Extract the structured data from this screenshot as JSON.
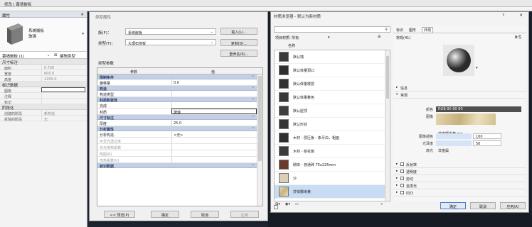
{
  "ribbon": {
    "context": "修改 | 幕墙嵌板"
  },
  "properties": {
    "header": "属性",
    "family": "系统嵌板",
    "type": "玻璃",
    "selector": "幕墙嵌板 (1)",
    "edit_type": "编辑类型",
    "categories": [
      {
        "name": "尺寸标注",
        "rows": [
          [
            "面积",
            "0.720"
          ],
          [
            "宽度",
            "600.0"
          ],
          [
            "高度",
            "1200.0"
          ]
        ]
      },
      {
        "name": "标识数据",
        "rows": [
          [
            "图像",
            ""
          ],
          [
            "注释",
            ""
          ],
          [
            "标记",
            ""
          ]
        ]
      },
      {
        "name": "阶段化",
        "rows": [
          [
            "创建的阶段",
            "新构造"
          ],
          [
            "拆除的阶段",
            "无"
          ]
        ]
      }
    ]
  },
  "type_props": {
    "title": "类型属性",
    "family_label": "族(F)：",
    "family_value": "系统嵌板",
    "type_label": "类型(T)：",
    "type_value": "大理石地板",
    "load_button": "载入(L)...",
    "duplicate_button": "复制(D)...",
    "rename_button": "重命名(R)...",
    "section_label": "类型参数",
    "col_param": "参数",
    "col_value": "值",
    "groups": [
      {
        "name": "限制条件",
        "rows": [
          {
            "k": "偏移量",
            "v": "0.0"
          }
        ]
      },
      {
        "name": "构造",
        "rows": [
          {
            "k": "构造类型",
            "v": ""
          }
        ]
      },
      {
        "name": "材质和装饰",
        "rows": [
          {
            "k": "完成",
            "v": ""
          },
          {
            "k": "材质",
            "v": "玻璃"
          }
        ]
      },
      {
        "name": "尺寸标注",
        "rows": [
          {
            "k": "厚度",
            "v": "25.0"
          }
        ]
      },
      {
        "name": "分析属性",
        "rows": [
          {
            "k": "分析构造",
            "v": "<无>"
          },
          {
            "k": "可见光透过率",
            "v": ""
          },
          {
            "k": "日光得热系数",
            "v": ""
          },
          {
            "k": "热阻(R)",
            "v": ""
          },
          {
            "k": "传热系数(U)",
            "v": ""
          }
        ]
      },
      {
        "name": "标识数据",
        "rows": []
      }
    ],
    "preview_button": "<< 预览(P)",
    "ok_button": "确定",
    "cancel_button": "取消",
    "apply_button": "应用"
  },
  "material_browser": {
    "title": "材质浏览器 - 默认为新材质",
    "help": "?",
    "close": "✕",
    "search_placeholder": "",
    "filter_label": "项目材质: 所有",
    "name_header": "名称",
    "materials": [
      {
        "name": "默认墙",
        "color": "#3a3a3a"
      },
      {
        "name": "默认体量洞口",
        "color": "#2e2e2e"
      },
      {
        "name": "默认体量楼层",
        "color": "#333333"
      },
      {
        "name": "默认体量着色",
        "color": "#383838"
      },
      {
        "name": "默认屋顶",
        "color": "#3f3f3f"
      },
      {
        "name": "默认形状",
        "color": "#353535"
      },
      {
        "name": "木材 - 层压板 - 象牙白，粗面",
        "color": "#2f2f2f"
      },
      {
        "name": "木材 - 刨花板",
        "color": "#3b3b3b"
      },
      {
        "name": "砌体 - 普通砖 75x225mm",
        "color": "#6a3b2a"
      },
      {
        "name": "沙",
        "color": "#d9cfb8"
      },
      {
        "name": "莎安娜米黄",
        "color": "#d8c9a4"
      }
    ],
    "tabs": [
      "标识",
      "图形",
      "外观"
    ],
    "asset_name": "常规(41)",
    "sections_top": [
      "信息",
      "常规"
    ],
    "fields": [
      {
        "k": "颜色",
        "v": "RGB 80 80 80"
      },
      {
        "k": "图像",
        "v": ""
      },
      {
        "k": "",
        "v": "莎安娜米黄.jpg"
      },
      {
        "k": "图像褪色",
        "v": "100"
      },
      {
        "k": "光泽度",
        "v": "50"
      },
      {
        "k": "高光",
        "v": "非金属"
      }
    ],
    "sections_bottom": [
      "反射率",
      "透明度",
      "剪切",
      "自发光",
      "凹凸"
    ],
    "ok_button": "确定",
    "cancel_button": "取消",
    "apply_button": "应用(A)"
  }
}
